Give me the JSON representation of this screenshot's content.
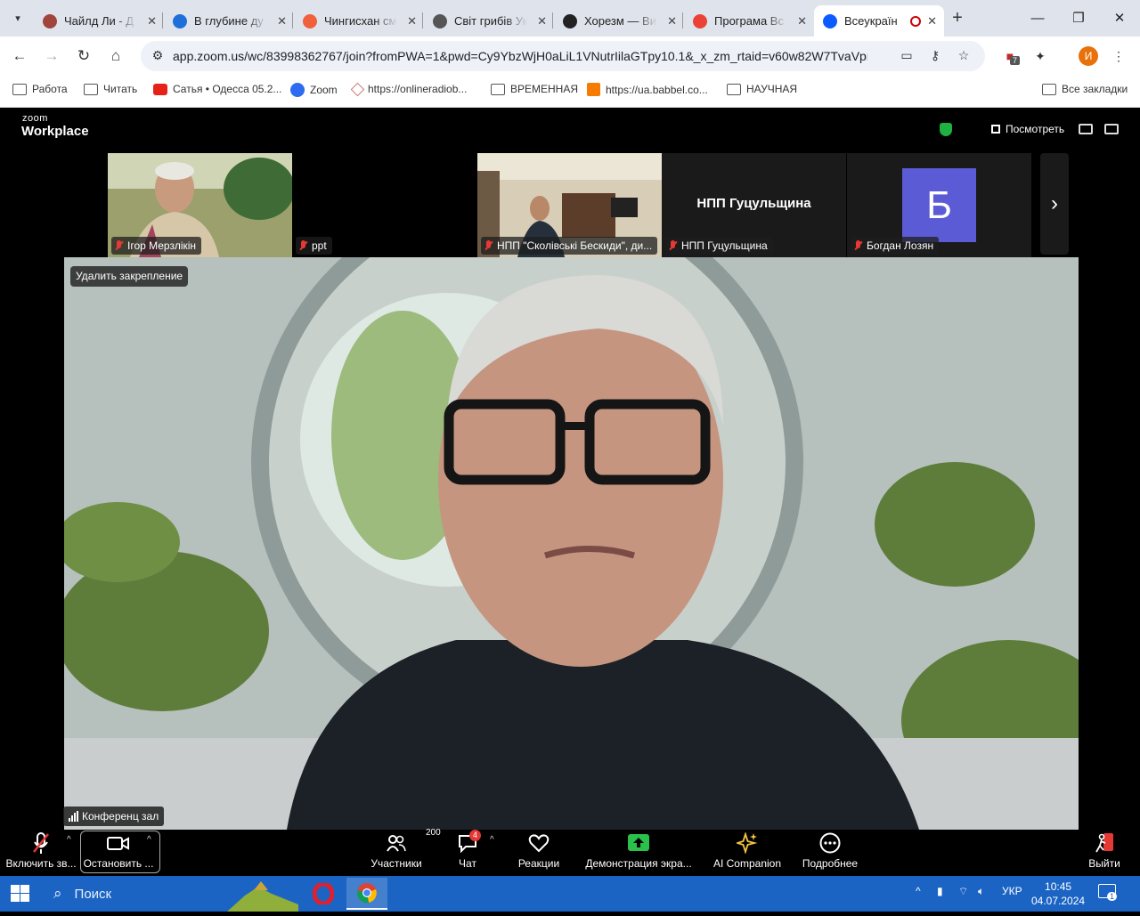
{
  "browser": {
    "tabs": [
      {
        "title": "Чайлд Ли - Д",
        "favicon": "reddish-circle-icon",
        "color": "#a0453b"
      },
      {
        "title": "В глубине ду",
        "favicon": "azure-icon",
        "color": "#1e6fd9"
      },
      {
        "title": "Чингисхан см",
        "favicon": "f-icon",
        "color": "#f0603a"
      },
      {
        "title": "Світ грибів Ук",
        "favicon": "globe-icon",
        "color": "#555555"
      },
      {
        "title": "Хорезм — Ви",
        "favicon": "wikipedia-icon",
        "color": "#222222"
      },
      {
        "title": "Програма Вс",
        "favicon": "gmail-icon",
        "color": "#ea4335"
      },
      {
        "title": "Всеукраїн",
        "favicon": "zoom-icon",
        "color": "#0b5cff"
      }
    ],
    "url": "app.zoom.us/wc/83998362767/join?fromPWA=1&pwd=Cy9YbzWjH0aLiL1VNutrIilaGTpy10.1&_x_zm_rtaid=v60w82W7TvaVprSttW...",
    "extension_badge": "7",
    "profile_initial": "И",
    "bookmarks": [
      {
        "label": "Работа",
        "icon": "folder-icon"
      },
      {
        "label": "Читать",
        "icon": "folder-icon"
      },
      {
        "label": "Сатья • Одесса 05.2...",
        "icon": "youtube-icon"
      },
      {
        "label": "Zoom",
        "icon": "zoom-icon"
      },
      {
        "label": "https://onlineradiob...",
        "icon": "box-icon"
      },
      {
        "label": "ВРЕМЕННАЯ",
        "icon": "folder-icon"
      },
      {
        "label": "https://ua.babbel.co...",
        "icon": "babbel-icon"
      },
      {
        "label": "НАУЧНАЯ",
        "icon": "folder-icon"
      }
    ],
    "all_bookmarks": "Все закладки"
  },
  "zoom": {
    "logo_top": "zoom",
    "logo_bottom": "Workplace",
    "view_label": "Посмотреть",
    "participants_strip": [
      {
        "name": "Ігор Мерзлікін",
        "type": "video"
      },
      {
        "name": "ppt",
        "type": "blank"
      },
      {
        "name": "НПП \"Сколівські Бескиди\", ди...",
        "type": "video"
      },
      {
        "name": "НПП Гуцульщина",
        "type": "text",
        "center_text": "НПП Гуцульщина"
      },
      {
        "name": "Богдан Лозян",
        "type": "avatar",
        "initial": "Б",
        "color": "#5b5bd6"
      }
    ],
    "unpin_label": "Удалить закрепление",
    "main_speaker_label": "Конференц зал",
    "controls": {
      "unmute": "Включить зв...",
      "stop_video": "Остановить ...",
      "participants": "Участники",
      "participants_count": "200",
      "chat": "Чат",
      "chat_badge": "4",
      "reactions": "Реакции",
      "share": "Демонстрация экра...",
      "companion": "AI Companion",
      "more": "Подробнее",
      "leave": "Выйти"
    }
  },
  "taskbar": {
    "search_placeholder": "Поиск",
    "lang": "УКР",
    "time": "10:45",
    "date": "04.07.2024",
    "notification_count": "1"
  }
}
